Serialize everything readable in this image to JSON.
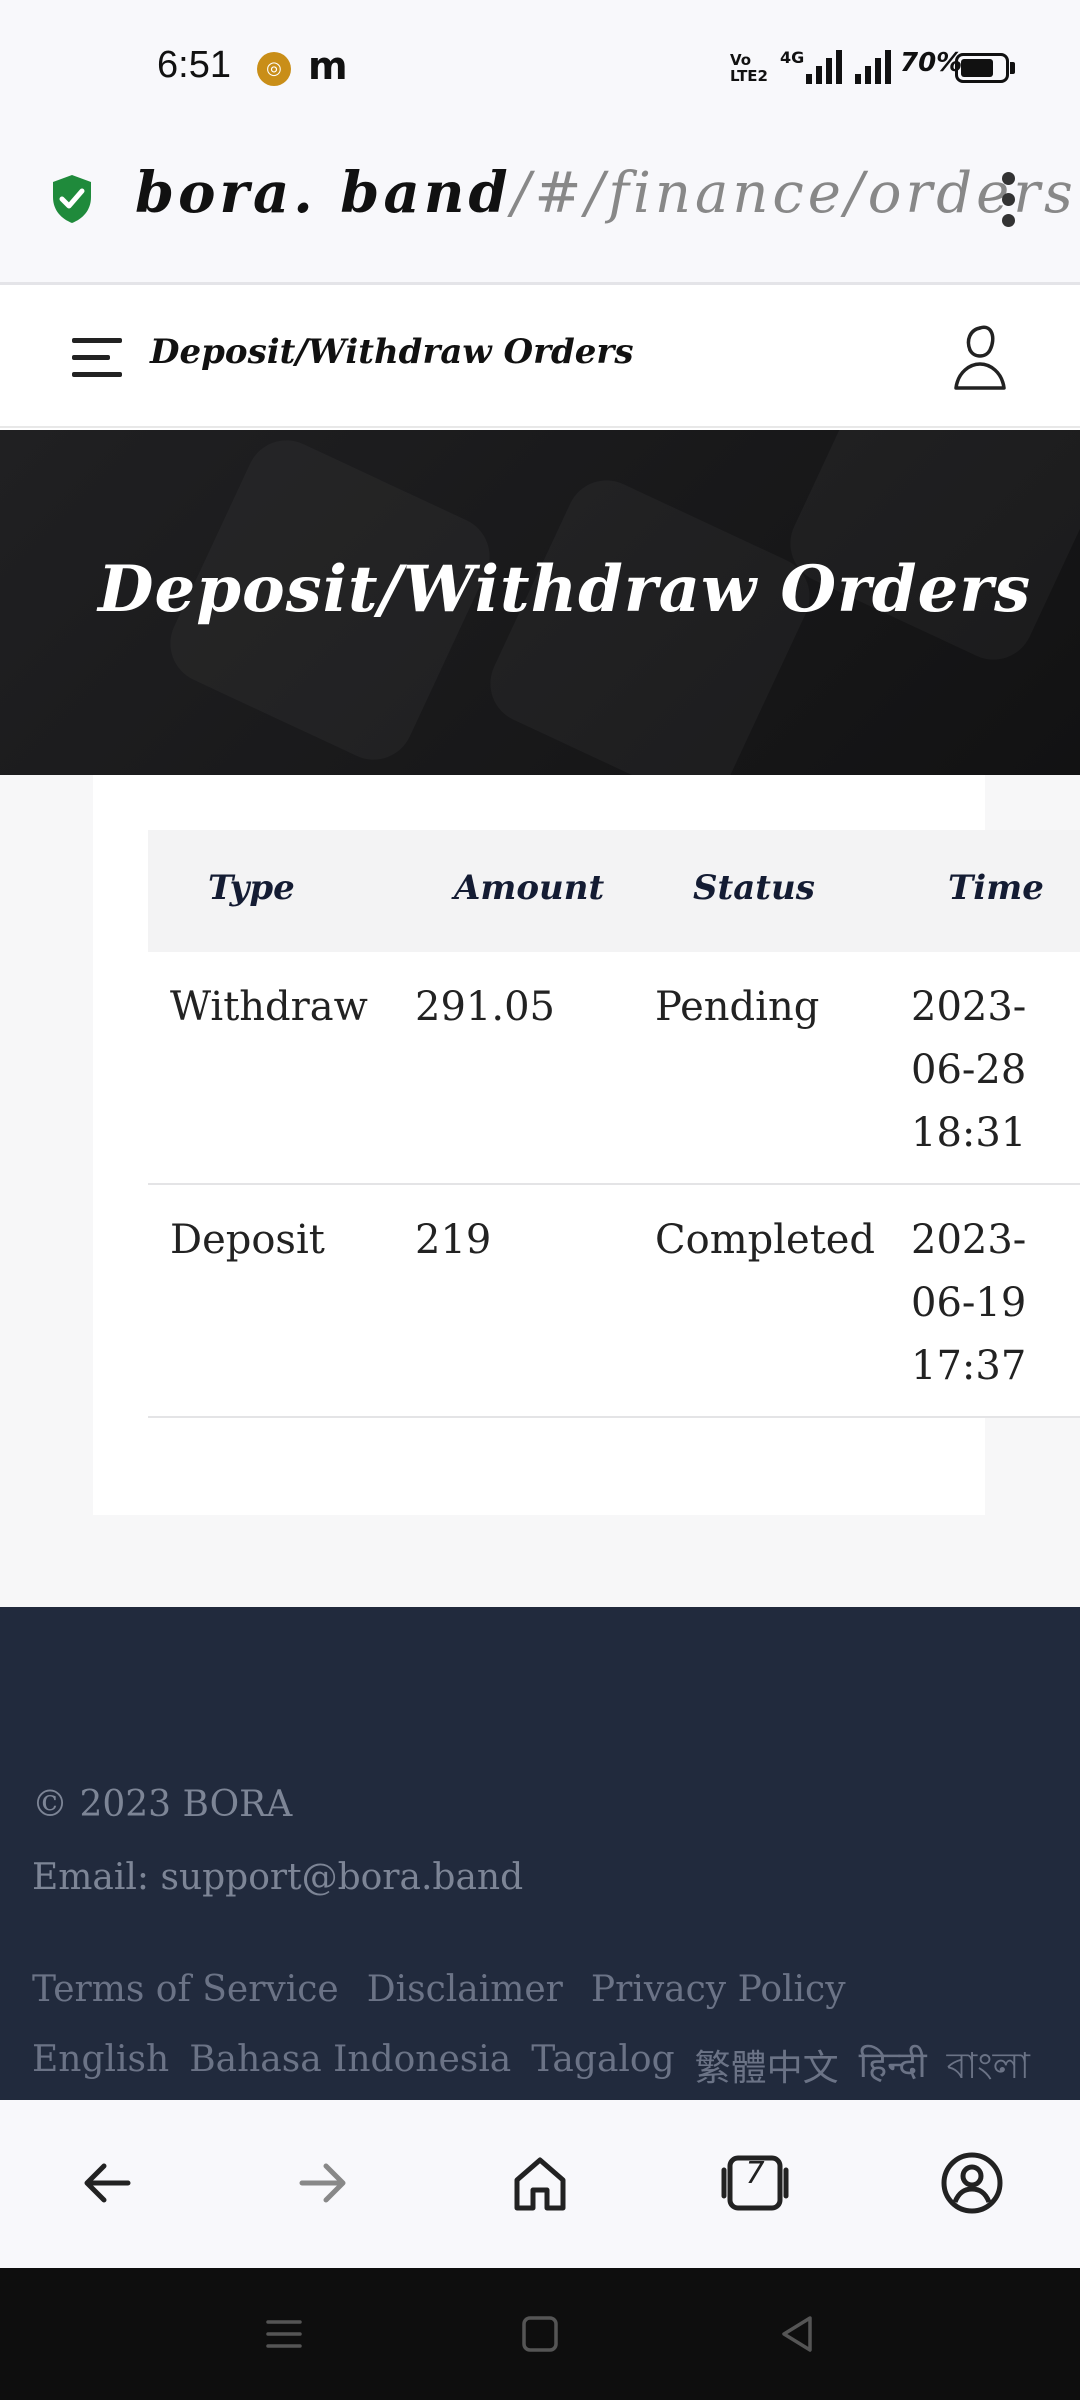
{
  "status_bar": {
    "time": "6:51",
    "notification_app": "m",
    "network_type": "4G",
    "volte": "VoLTE2",
    "battery_percent": "70%"
  },
  "url_bar": {
    "host": "bora. band",
    "path": "/#/finance/orders"
  },
  "header": {
    "title": "Deposit/Withdraw Orders"
  },
  "hero": {
    "title": "Deposit/Withdraw Orders"
  },
  "table": {
    "columns": [
      "Type",
      "Amount",
      "Status",
      "Time"
    ],
    "rows": [
      {
        "type": "Withdraw",
        "amount": "291.05",
        "status": "Pending",
        "time": "2023-06-28 18:31"
      },
      {
        "type": "Deposit",
        "amount": "219",
        "status": "Completed",
        "time": "2023-06-19 17:37"
      }
    ]
  },
  "footer": {
    "copyright": "© 2023 BORA",
    "email": "Email: support@bora.band",
    "links": [
      "Terms of Service",
      "Disclaimer",
      "Privacy Policy"
    ],
    "languages": [
      "English",
      "Bahasa Indonesia",
      "Tagalog",
      "繁體中文",
      "हिन्दी",
      "বাংলা"
    ]
  },
  "bottom_nav": {
    "tab_count": "7"
  },
  "colors": {
    "hero_bg": "#1a1a1b",
    "footer_bg": "#212a3d",
    "table_header_text": "#141c33",
    "shield_green": "#1f8a3b"
  },
  "icons": [
    "shield-check-icon",
    "menu-icon",
    "user-icon",
    "back-arrow-icon",
    "forward-arrow-icon",
    "home-icon",
    "tabs-icon",
    "account-icon"
  ]
}
